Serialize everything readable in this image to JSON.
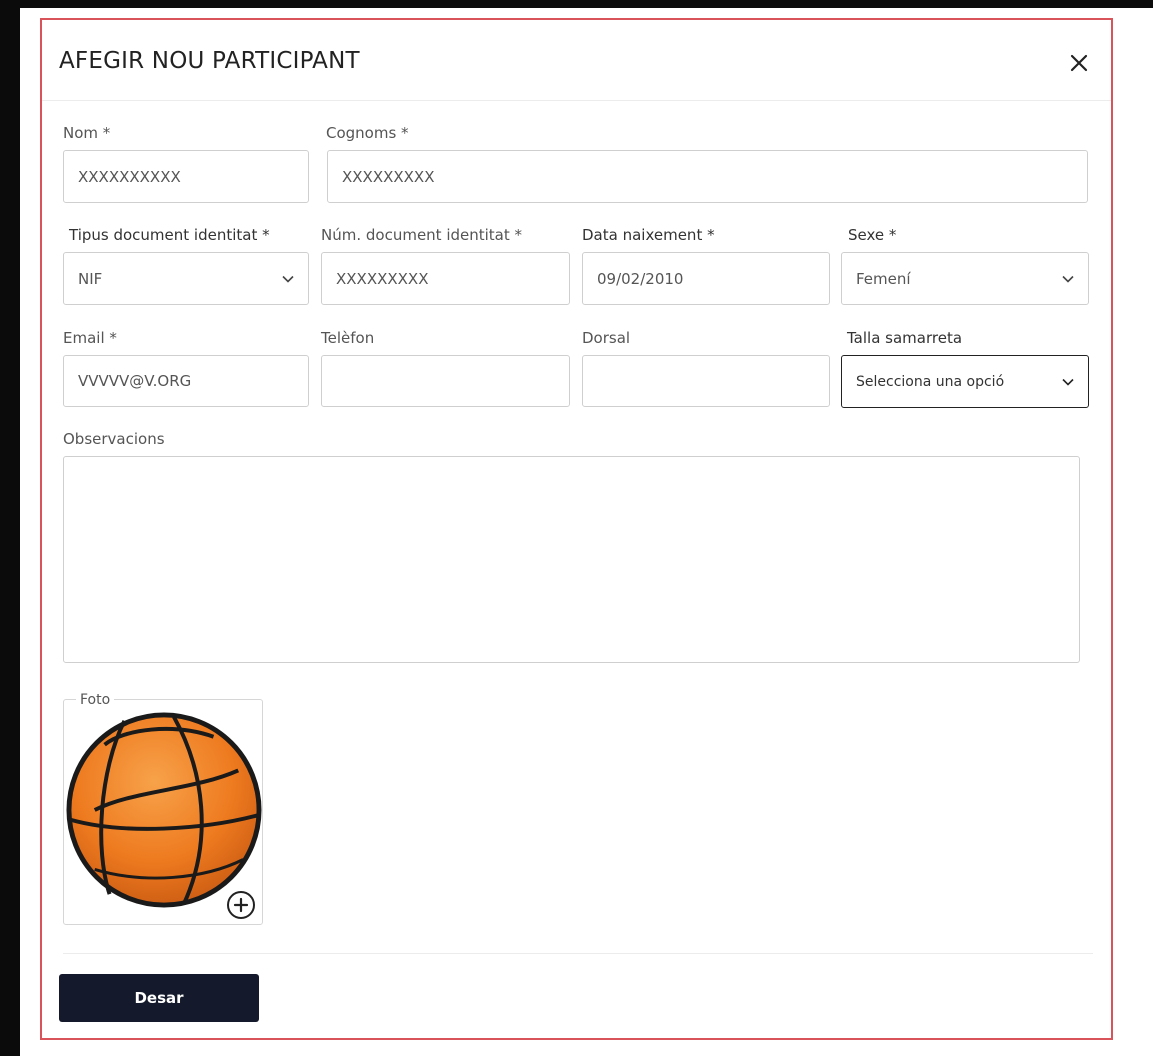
{
  "dialog": {
    "title": "AFEGIR NOU PARTICIPANT",
    "close_icon": "close-icon"
  },
  "form": {
    "nom": {
      "label": "Nom *",
      "value": "XXXXXXXXXX"
    },
    "cognoms": {
      "label": "Cognoms *",
      "value": "XXXXXXXXX"
    },
    "tipus_document": {
      "label": "Tipus document identitat *",
      "value": "NIF"
    },
    "num_document": {
      "label": "Núm. document identitat *",
      "value": "XXXXXXXXX"
    },
    "data_naixement": {
      "label": "Data naixement *",
      "value": "09/02/2010"
    },
    "sexe": {
      "label": "Sexe *",
      "value": "Femení"
    },
    "email": {
      "label": "Email *",
      "value": "VVVVV@V.ORG"
    },
    "telefon": {
      "label": "Telèfon",
      "value": ""
    },
    "dorsal": {
      "label": "Dorsal",
      "value": ""
    },
    "talla_samarreta": {
      "label": "Talla samarreta",
      "value": "Selecciona una opció"
    },
    "observacions": {
      "label": "Observacions",
      "value": ""
    },
    "foto": {
      "legend": "Foto",
      "image": "basketball",
      "add_icon": "plus-circle-icon"
    }
  },
  "actions": {
    "save_label": "Desar"
  },
  "colors": {
    "frame_border": "#d9535b",
    "button_bg": "#141a2b",
    "page_bg": "#0b0b0b"
  }
}
